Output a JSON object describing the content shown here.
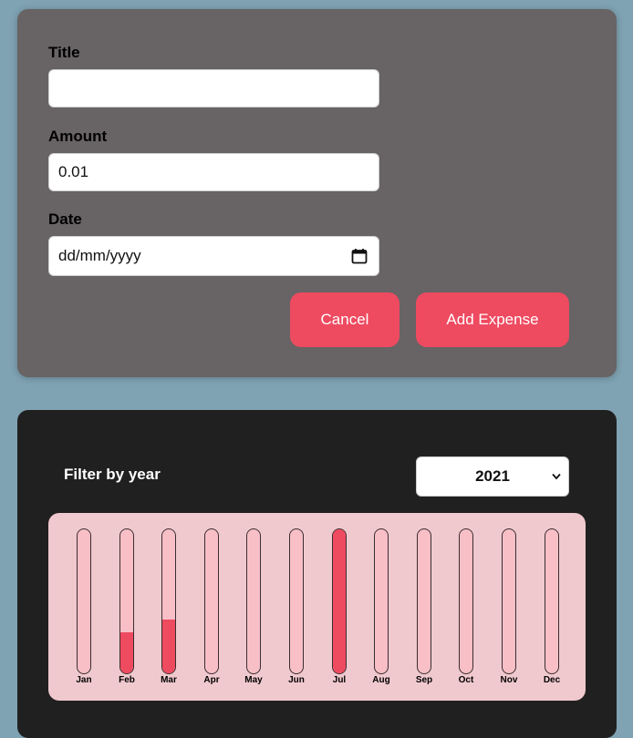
{
  "form": {
    "title_label": "Title",
    "title_value": "",
    "amount_label": "Amount",
    "amount_value": "0.01",
    "date_label": "Date",
    "date_placeholder": "dd/mm/yyyy",
    "cancel_label": "Cancel",
    "add_label": "Add Expense"
  },
  "filter": {
    "label": "Filter by year",
    "selected_year": "2021"
  },
  "colors": {
    "accent": "#ee4a60",
    "bar_track": "#f8bfc7",
    "chart_bg": "#f0c9ce"
  },
  "chart_data": {
    "type": "bar",
    "categories": [
      "Jan",
      "Feb",
      "Mar",
      "Apr",
      "May",
      "Jun",
      "Jul",
      "Aug",
      "Sep",
      "Oct",
      "Nov",
      "Dec"
    ],
    "values": [
      0,
      0.28,
      0.37,
      0,
      0,
      0,
      1.0,
      0,
      0,
      0,
      0,
      0
    ],
    "ylim": [
      0,
      1
    ]
  }
}
